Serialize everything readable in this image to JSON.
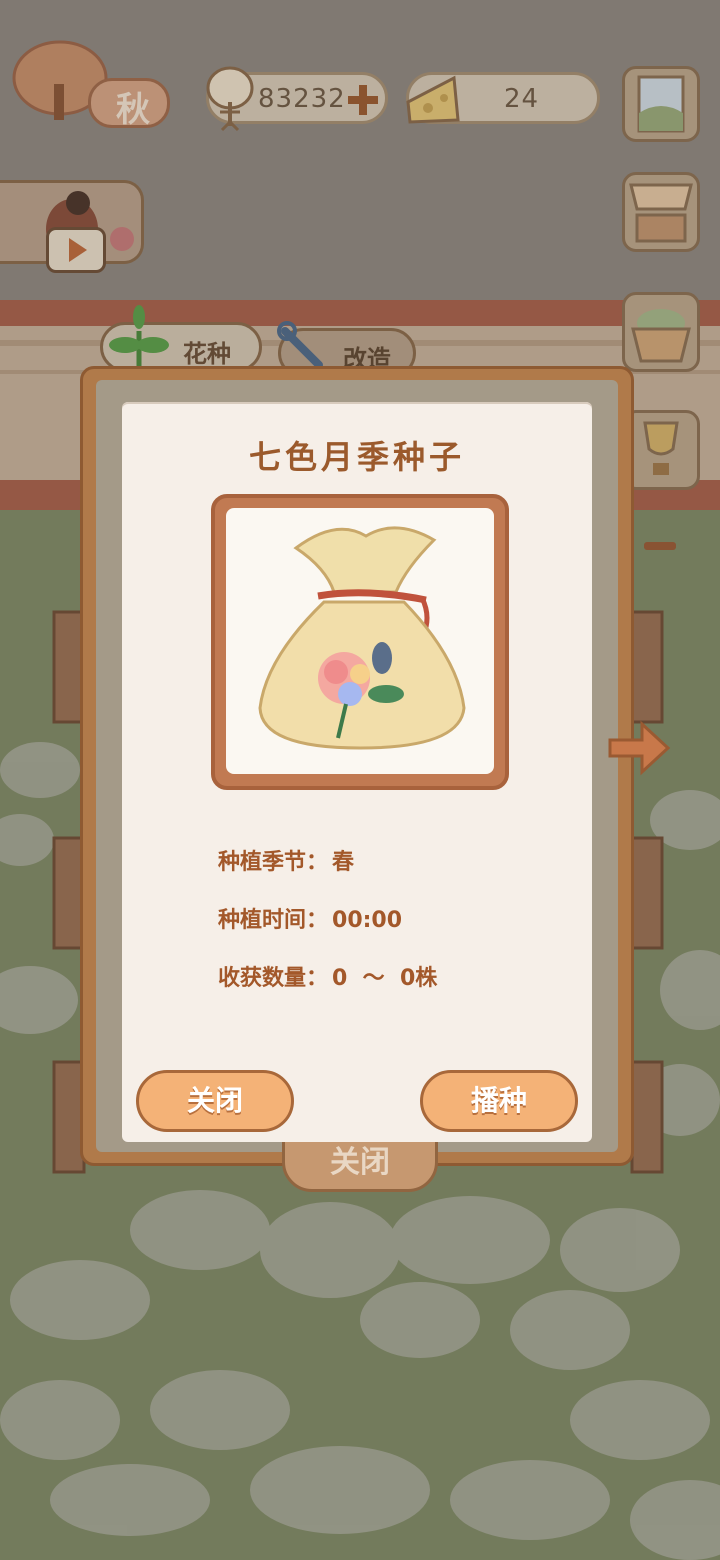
{
  "hud": {
    "season_char": "秋",
    "fish_count": "83232",
    "cheese_count": "24"
  },
  "tabs": [
    {
      "label": "花种"
    },
    {
      "label": "改造"
    }
  ],
  "dialog": {
    "title": "七色月季种子",
    "rows": [
      {
        "label": "种植季节：",
        "value": "春"
      },
      {
        "label": "种植时间：",
        "value": "00:00"
      },
      {
        "label": "收获数量：",
        "value": "0  ～  0株"
      }
    ],
    "close_label": "关闭",
    "sow_label": "播种"
  },
  "background_close_label": "关闭",
  "colors": {
    "accent_orange": "#f4b277",
    "title_brown": "#9b5a2c",
    "frame_brown": "#b07a4a",
    "grass": "#7f8a66"
  }
}
